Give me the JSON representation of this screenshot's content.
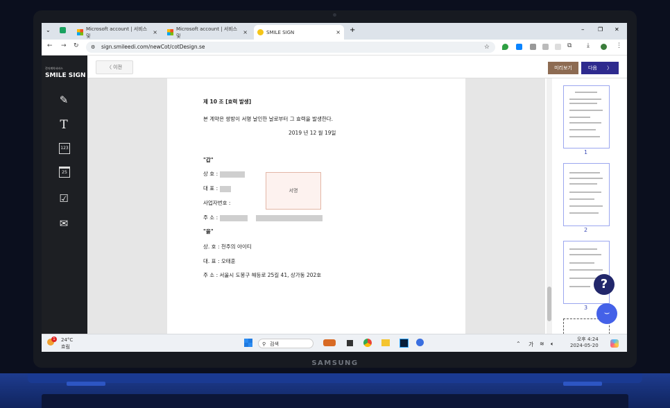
{
  "browser": {
    "tabs": [
      {
        "label": "Microsoft account | 서비스 및",
        "icon": "microsoft-icon",
        "active": false
      },
      {
        "label": "Microsoft account | 서비스 및",
        "icon": "microsoft-icon",
        "active": false
      },
      {
        "label": "SMILE SIGN",
        "icon": "smile-icon",
        "active": true
      }
    ],
    "tab_close": "×",
    "new_tab": "+",
    "url": "sign.smileedi.com/newCot/cotDesign.se",
    "window_controls": {
      "minimize": "–",
      "restore": "❐",
      "close": "✕"
    }
  },
  "app": {
    "logo": {
      "subtitle": "전자계약서비스",
      "text": "SMILE SIGN"
    },
    "prev_label": "이전",
    "preview_label": "미리보기",
    "next_label": "다음",
    "sidebar_tools": [
      {
        "name": "pen-icon",
        "glyph": "✎"
      },
      {
        "name": "text-icon",
        "glyph": "T"
      },
      {
        "name": "number-icon",
        "glyph": "123"
      },
      {
        "name": "calendar-icon",
        "glyph": "25"
      },
      {
        "name": "checkbox-icon",
        "glyph": "☑"
      },
      {
        "name": "mail-icon",
        "glyph": "✉"
      }
    ]
  },
  "document": {
    "article_title": "제 10 조 [효력 발생]",
    "article_body": "본 계약은 쌍방이 서명 날인한 날로부터 그 효력을 발생한다.",
    "date": "2019 년 12 월 19일",
    "party_a": {
      "label": "\"갑\"",
      "company_label": "상      호 :",
      "rep_label": "대      표 :",
      "biz_label": "사업자번호 :",
      "addr_label": "주      소 :"
    },
    "signature_label": "서명",
    "party_b": {
      "label": "\"을\"",
      "company": "상.      호 : 천주의 아이티",
      "rep": "대.      표 : 오태훈",
      "addr": "주      소 : 서울시 도봉구 해등로 25길 41, 상가동 202호"
    }
  },
  "thumbnails": {
    "pages": [
      "1",
      "2",
      "3"
    ]
  },
  "widgets": {
    "help": "?",
    "chat": "⌣"
  },
  "taskbar": {
    "weather_temp": "24°C",
    "weather_desc": "흐림",
    "weather_badge": "1",
    "search_placeholder": "검색",
    "tray_ime": "가",
    "time": "오후 4:24",
    "date": "2024-05-20"
  },
  "device": {
    "brand": "SAMSUNG"
  }
}
